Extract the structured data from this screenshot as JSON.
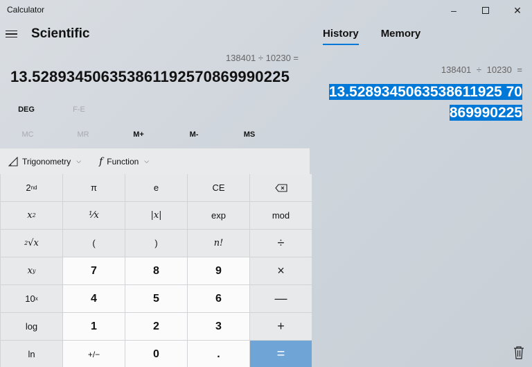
{
  "window": {
    "title": "Calculator",
    "minimize": "–",
    "close": "✕"
  },
  "header": {
    "mode_title": "Scientific"
  },
  "display": {
    "expression": "138401 ÷ 10230 =",
    "value": "13.528934506353861192570869990225"
  },
  "mode_buttons": [
    {
      "label": "DEG"
    },
    {
      "label": "F-E"
    }
  ],
  "memory_buttons": [
    {
      "label": "MC"
    },
    {
      "label": "MR"
    },
    {
      "label": "M+"
    },
    {
      "label": "M-"
    },
    {
      "label": "MS"
    }
  ],
  "function_bar": {
    "trig_label": "Trigonometry",
    "func_label": "Function",
    "func_icon": "f",
    "chevron": "⌵"
  },
  "keys": {
    "pi": "π",
    "e": "e",
    "ce": "CE",
    "backspace": "⌫",
    "reciprocal": "⅟x",
    "abs": "|x|",
    "exp": "exp",
    "mod": "mod",
    "open_paren": "(",
    "close_paren": ")",
    "factorial": "n!",
    "divide": "÷",
    "multiply": "×",
    "minus": "—",
    "plus": "+",
    "equals": "=",
    "log": "log",
    "ln": "ln",
    "negate": "+/−",
    "decimal": ".",
    "d7": "7",
    "d8": "8",
    "d9": "9",
    "d4": "4",
    "d5": "5",
    "d6": "6",
    "d1": "1",
    "d2": "2",
    "d3": "3",
    "d0": "0"
  },
  "history": {
    "tabs": [
      {
        "label": "History"
      },
      {
        "label": "Memory"
      }
    ],
    "entry_expression": "138401 ÷ 10230 =",
    "entry_result_line1": "13.5289345063538611925 70",
    "entry_result_line2": "869990225"
  }
}
